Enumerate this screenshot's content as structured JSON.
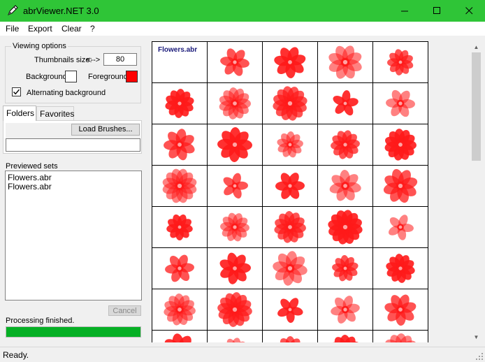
{
  "window": {
    "title": "abrViewer.NET 3.0"
  },
  "menu": [
    {
      "label": "File"
    },
    {
      "label": "Export"
    },
    {
      "label": "Clear"
    },
    {
      "label": "?"
    }
  ],
  "viewing_options": {
    "legend": "Viewing options",
    "thumb_size_label": "Thumbnails size:",
    "thumb_arrows": "<-->",
    "thumb_size_value": "80",
    "background_label": "Background:",
    "background_color": "#ffffff",
    "foreground_label": "Foreground:",
    "foreground_color": "#ff0000",
    "alternating_label": "Alternating background",
    "alternating_checked": true
  },
  "tabs": [
    {
      "label": "Folders",
      "active": true
    },
    {
      "label": "Favorites",
      "active": false
    }
  ],
  "folders": {
    "load_button": "Load Brushes...",
    "path_value": ""
  },
  "previewed": {
    "label": "Previewed sets",
    "items": [
      "Flowers.abr",
      "Flowers.abr"
    ]
  },
  "cancel_button": "Cancel",
  "processing": {
    "status": "Processing finished.",
    "progress": 1.0
  },
  "thumbnails": {
    "set_name": "Flowers.abr",
    "columns": 5,
    "visible_rows": 8,
    "brush_color": "#ff1a1a",
    "icons": [
      "flower-brush-icon"
    ]
  },
  "statusbar": {
    "text": "Ready."
  }
}
